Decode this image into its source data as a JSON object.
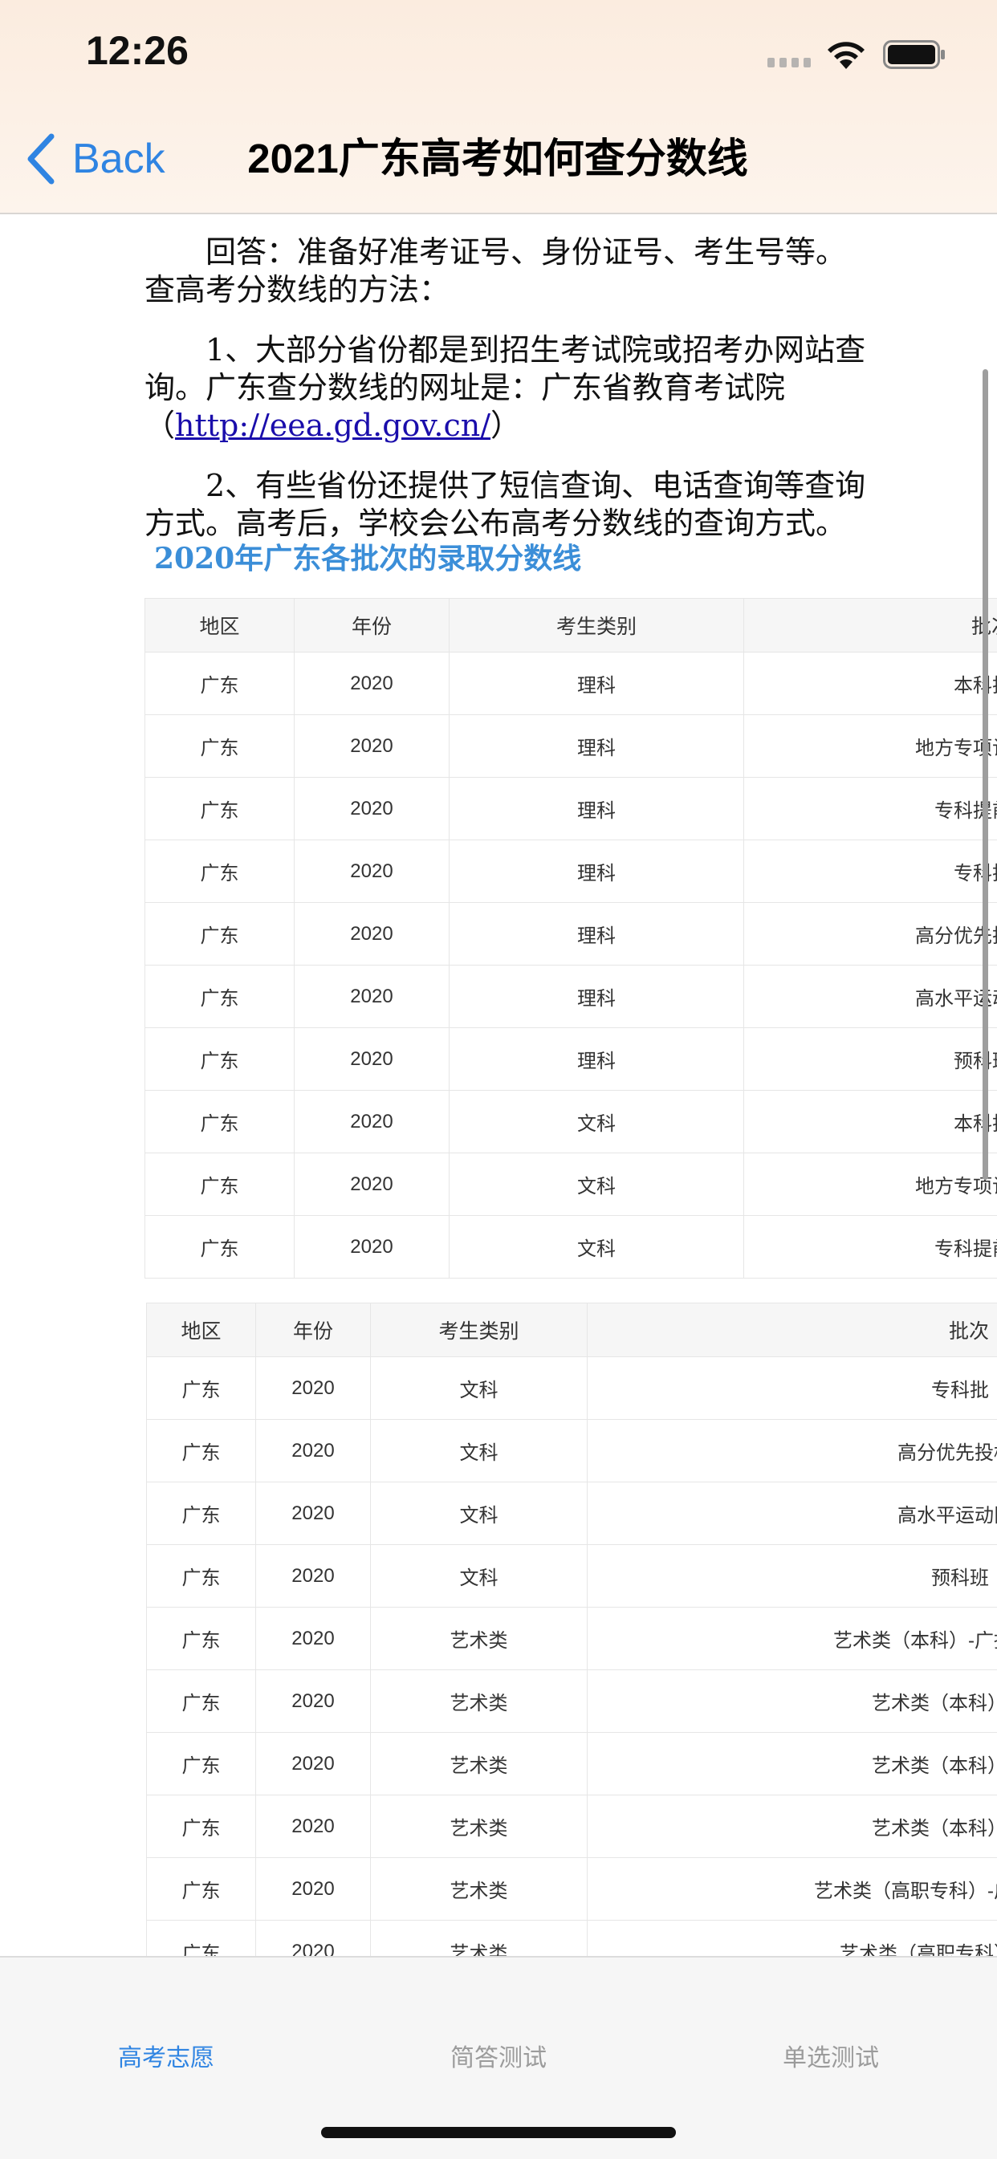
{
  "status_bar": {
    "time": "12:26"
  },
  "nav": {
    "back_label": "Back",
    "title": "2021广东高考如何查分数线"
  },
  "article": {
    "p1": "回答：准备好准考证号、身份证号、考生号等。查高考分数线的方法：",
    "p2_before": "1、大部分省份都是到招生考试院或招考办网站查询。广东查分数线的网址是：广东省教育考试院（",
    "p2_link": "http://eea.gd.gov.cn/",
    "p2_after": "）",
    "p3": "2、有些省份还提供了短信查询、电话查询等查询方式。高考后，学校会公布高考分数线的查询方式。",
    "heading": "2020年广东各批次的录取分数线"
  },
  "table1": {
    "headers": [
      "地区",
      "年份",
      "考生类别",
      "批次"
    ],
    "rows": [
      [
        "广东",
        "2020",
        "理科",
        "本科批"
      ],
      [
        "广东",
        "2020",
        "理科",
        "地方专项计"
      ],
      [
        "广东",
        "2020",
        "理科",
        "专科提前"
      ],
      [
        "广东",
        "2020",
        "理科",
        "专科批"
      ],
      [
        "广东",
        "2020",
        "理科",
        "高分优先投"
      ],
      [
        "广东",
        "2020",
        "理科",
        "高水平运动"
      ],
      [
        "广东",
        "2020",
        "理科",
        "预科班"
      ],
      [
        "广东",
        "2020",
        "文科",
        "本科批"
      ],
      [
        "广东",
        "2020",
        "文科",
        "地方专项计"
      ],
      [
        "广东",
        "2020",
        "文科",
        "专科提前"
      ]
    ]
  },
  "table2": {
    "headers": [
      "地区",
      "年份",
      "考生类别",
      "批次"
    ],
    "rows": [
      [
        "广东",
        "2020",
        "文科",
        "专科批"
      ],
      [
        "广东",
        "2020",
        "文科",
        "高分优先投档"
      ],
      [
        "广东",
        "2020",
        "文科",
        "高水平运动队"
      ],
      [
        "广东",
        "2020",
        "文科",
        "预科班"
      ],
      [
        "广东",
        "2020",
        "艺术类",
        "艺术类（本科）-广播"
      ],
      [
        "广东",
        "2020",
        "艺术类",
        "艺术类（本科）-"
      ],
      [
        "广东",
        "2020",
        "艺术类",
        "艺术类（本科）-"
      ],
      [
        "广东",
        "2020",
        "艺术类",
        "艺术类（本科）-"
      ],
      [
        "广东",
        "2020",
        "艺术类",
        "艺术类（高职专科）-广"
      ],
      [
        "广东",
        "2020",
        "艺术类",
        "艺术类（高职专科）"
      ]
    ]
  },
  "tabbar": {
    "tabs": [
      "高考志愿",
      "简答测试",
      "单选测试"
    ]
  },
  "colors": {
    "accent": "#2f84e2",
    "heading_blue": "#3b8ed8",
    "link": "#1a0dab"
  }
}
